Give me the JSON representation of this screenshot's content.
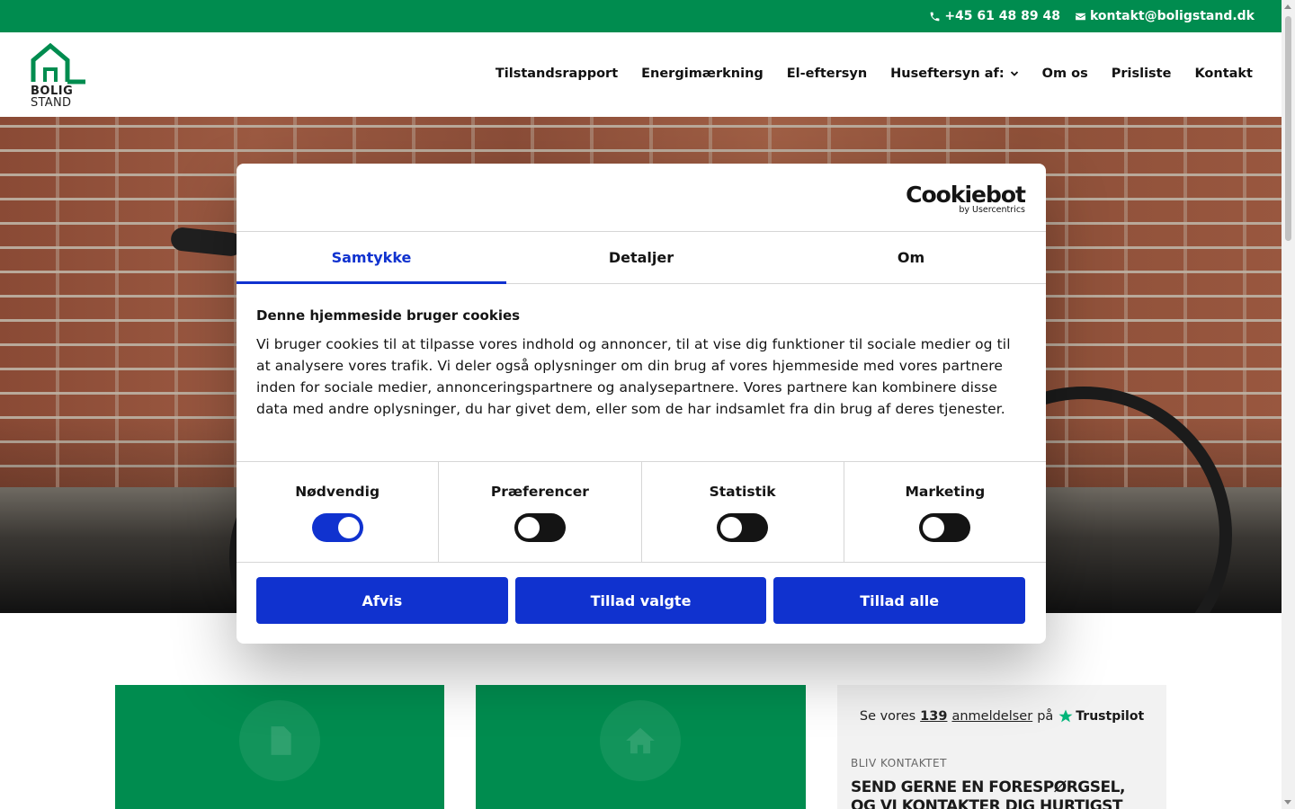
{
  "topbar": {
    "phone": "+45 61 48 89 48",
    "email": "kontakt@boligstand.dk"
  },
  "logo": {
    "line1": "BOLIG",
    "line2": "STAND"
  },
  "nav": {
    "items": [
      {
        "label": "Tilstandsrapport"
      },
      {
        "label": "Energimærkning"
      },
      {
        "label": "El-eftersyn"
      },
      {
        "label": "Huseftersyn af:"
      },
      {
        "label": "Om os"
      },
      {
        "label": "Prisliste"
      },
      {
        "label": "Kontakt"
      }
    ]
  },
  "cookie_dialog": {
    "brand": "Cookiebot",
    "brand_sub": "by Usercentrics",
    "tabs": [
      {
        "label": "Samtykke",
        "active": true
      },
      {
        "label": "Detaljer",
        "active": false
      },
      {
        "label": "Om",
        "active": false
      }
    ],
    "title": "Denne hjemmeside bruger cookies",
    "text": "Vi bruger cookies til at tilpasse vores indhold og annoncer, til at vise dig funktioner til sociale medier og til at analysere vores trafik. Vi deler også oplysninger om din brug af vores hjemmeside med vores partnere inden for sociale medier, annonceringspartnere og analysepartnere. Vores partnere kan kombinere disse data med andre oplysninger, du har givet dem, eller som de har indsamlet fra din brug af deres tjenester.",
    "toggles": [
      {
        "label": "Nødvendig",
        "on": true
      },
      {
        "label": "Præferencer",
        "on": false
      },
      {
        "label": "Statistik",
        "on": false
      },
      {
        "label": "Marketing",
        "on": false
      }
    ],
    "buttons": {
      "reject": "Afvis",
      "allow_selected": "Tillad valgte",
      "allow_all": "Tillad alle"
    }
  },
  "trustpilot": {
    "prefix": "Se vores",
    "count": "139",
    "reviews_word": "anmeldelser",
    "suffix": "på",
    "brand": "Trustpilot"
  },
  "contact_card": {
    "label": "BLIV KONTAKTET",
    "heading": "SEND GERNE EN FORESPØRGSEL, OG VI KONTAKTER DIG HURTIGST MULIGT"
  },
  "colors": {
    "brand_green": "#008c4f",
    "cookie_blue": "#1032cf"
  }
}
